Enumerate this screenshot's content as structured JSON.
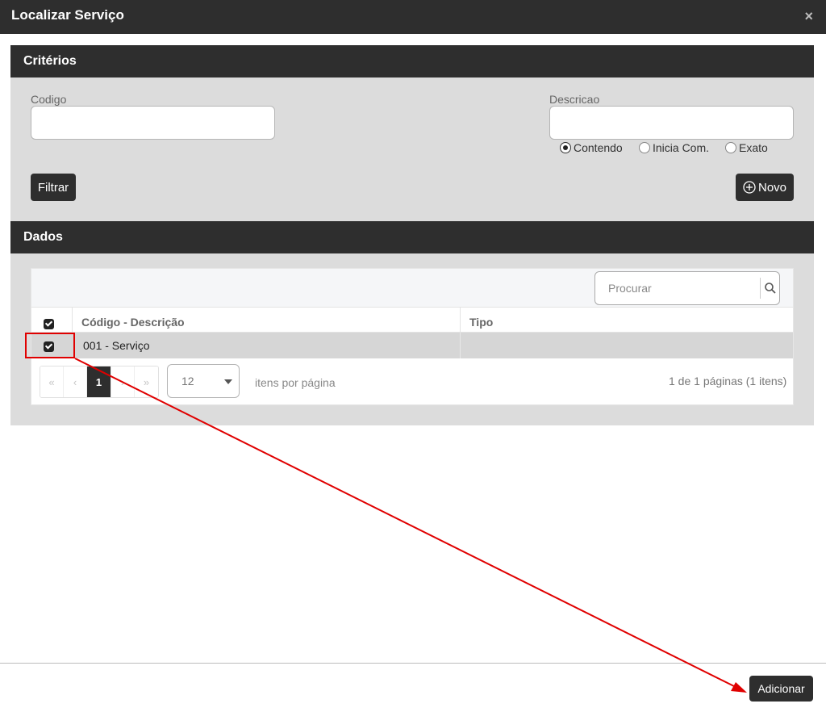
{
  "dialog": {
    "title": "Localizar Serviço",
    "close_symbol": "×"
  },
  "criteria": {
    "header": "Critérios",
    "codigo_label": "Codigo",
    "codigo_value": "",
    "descricao_label": "Descricao",
    "descricao_value": "",
    "match_options": [
      {
        "label": "Contendo",
        "selected": true
      },
      {
        "label": "Inicia Com.",
        "selected": false
      },
      {
        "label": "Exato",
        "selected": false
      }
    ],
    "filter_button": "Filtrar",
    "new_button": "Novo"
  },
  "data": {
    "header": "Dados",
    "search_placeholder": "Procurar",
    "columns": [
      "Código - Descrição",
      "Tipo"
    ],
    "rows": [
      {
        "checked": true,
        "descricao": "001 - Serviço",
        "tipo": ""
      }
    ],
    "pager": {
      "first": "«",
      "prev": "‹",
      "current": "1",
      "next": "›",
      "last": "»"
    },
    "page_size": "12",
    "page_size_label": "itens por página",
    "pages_info": "1 de 1 páginas (1 itens)"
  },
  "footer": {
    "add_button": "Adicionar"
  },
  "colors": {
    "dark": "#2e2e2e",
    "panel": "#dcdcdc",
    "annotation": "#e00000"
  }
}
